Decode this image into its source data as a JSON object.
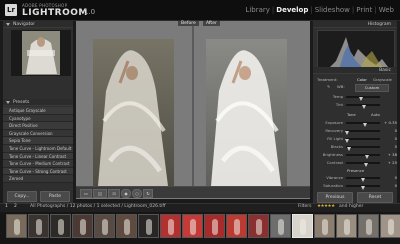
{
  "app": {
    "logo": "Lr",
    "brand_small": "ADOBE PHOTOSHOP",
    "brand": "LIGHTROOM",
    "version": "1.0"
  },
  "modules": [
    "Library",
    "Develop",
    "Slideshow",
    "Print",
    "Web"
  ],
  "active_module": "Develop",
  "left_panel": {
    "navigator_title": "Navigator",
    "presets_title": "Presets",
    "presets": [
      "Antique Grayscale",
      "Cyanotype",
      "Direct Positive",
      "Grayscale Conversion",
      "Sepia Tone",
      "Tone Curve - Lightroom Default",
      "Tone Curve - Linear Contrast",
      "Tone Curve - Medium Contrast",
      "Tone Curve - Strong Contrast",
      "Zeroed"
    ],
    "copy_label": "Copy...",
    "paste_label": "Paste"
  },
  "main": {
    "before_label": "Before",
    "after_label": "After"
  },
  "right_panel": {
    "histogram_title": "Histogram",
    "basic_title": "Basic",
    "treatment_label": "Treatment:",
    "color_label": "Color",
    "grayscale_label": "Grayscale",
    "wb_label": "WB:",
    "wb_value": "Custom",
    "tone_label": "Tone",
    "auto_label": "Auto",
    "presence_label": "Presence",
    "wb_sliders": [
      {
        "label": "Temp",
        "value": "",
        "pos": 0.45
      },
      {
        "label": "Tint",
        "value": "",
        "pos": 0.55
      }
    ],
    "tone_sliders": [
      {
        "label": "Exposure",
        "value": "+ 0.35",
        "pos": 0.56
      },
      {
        "label": "Recovery",
        "value": "0",
        "pos": 0.05
      },
      {
        "label": "Fill Light",
        "value": "0",
        "pos": 0.05
      },
      {
        "label": "Blacks",
        "value": "5",
        "pos": 0.1
      },
      {
        "label": "Brightness",
        "value": "+ 38",
        "pos": 0.62
      },
      {
        "label": "Contrast",
        "value": "+ 25",
        "pos": 0.6
      }
    ],
    "presence_sliders": [
      {
        "label": "Vibrance",
        "value": "0",
        "pos": 0.5
      },
      {
        "label": "Saturation",
        "value": "0",
        "pos": 0.5
      }
    ],
    "previous_label": "Previous",
    "reset_label": "Reset"
  },
  "filmstrip": {
    "page_numbers": [
      "1",
      "2"
    ],
    "path": "All Photographs / 12 photos / 1 selected / Lightroom_026.tiff",
    "filters_label": "Filters",
    "filter_suffix": "and higher",
    "thumbnail_count": 18,
    "selected_index": 13
  }
}
